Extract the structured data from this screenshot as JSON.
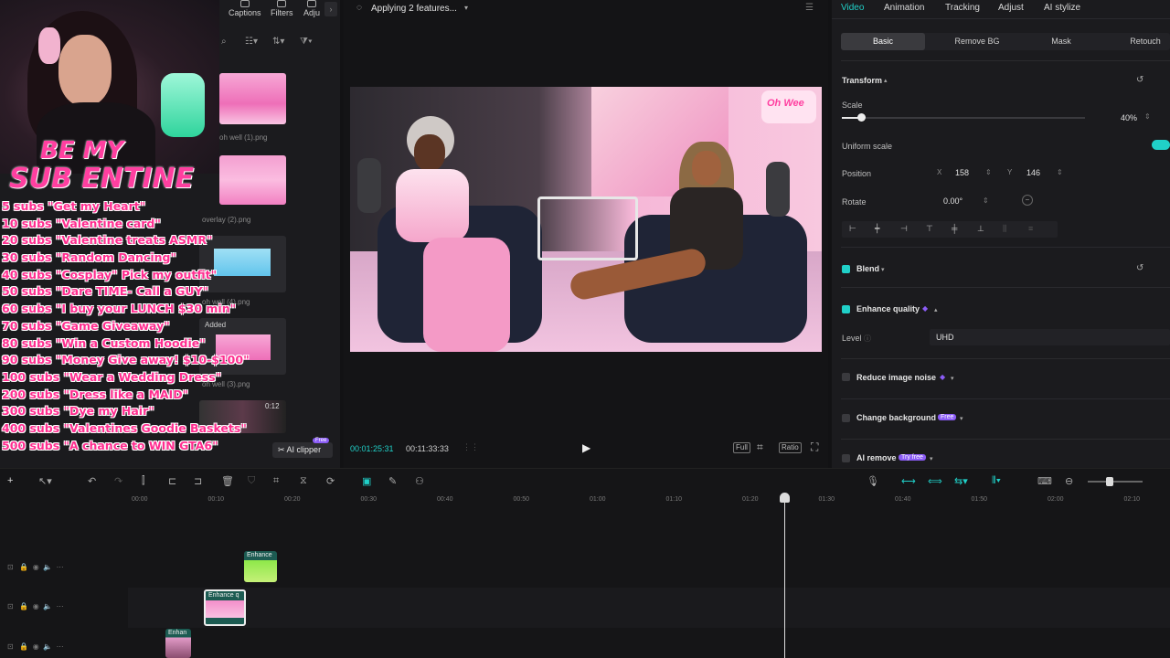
{
  "media_tabs": [
    "Captions",
    "Filters",
    "Adju"
  ],
  "media_items": [
    {
      "label": "oh well (1).png"
    },
    {
      "label": "overlay (2).png"
    },
    {
      "label": "oh well (4).png"
    },
    {
      "label": "oh well (3).png",
      "badge": "Added"
    },
    {
      "label": "0:12"
    }
  ],
  "ai_clipper": {
    "label": "AI clipper",
    "badge": "Free"
  },
  "webcam": {
    "line1": "BE MY",
    "line2": "SUB ENTINE"
  },
  "sub_goals": [
    "5 subs \"Get my Heart\"",
    "10 subs \"Valentine card\"",
    "20 subs \"Valentine treats ASMR\"",
    "30 subs \"Random Dancing\"",
    "40 subs \"Cosplay\" Pick my outfit\"",
    "50 subs \"Dare TIME- Call a GUY\"",
    "60 subs \"I buy your LUNCH $30 min\"",
    "70 subs \"Game Giveaway\"",
    "80 subs \"Win a Custom Hoodie\"",
    "90 subs \"Money Give away! $10-$100\"",
    "100 subs \"Wear a Wedding Dress\"",
    "200 subs \"Dress like a MAID\"",
    "300 subs \"Dye my Hair\"",
    "400 subs \"Valentines Goodie Baskets\"",
    "500 subs \"A chance to WIN GTA6\""
  ],
  "player": {
    "status": "Applying 2 features...",
    "current_time": "00:01:25:31",
    "total_time": "00:11:33:33",
    "btn_full": "Full",
    "btn_ratio": "Ratio",
    "logo_text": "Oh Wee"
  },
  "inspector": {
    "tabs": [
      "Video",
      "Animation",
      "Tracking",
      "Adjust",
      "AI stylize"
    ],
    "active_tab": "Video",
    "sub_tabs": [
      "Basic",
      "Remove BG",
      "Mask",
      "Retouch"
    ],
    "transform_title": "Transform",
    "scale_label": "Scale",
    "scale_value": "40%",
    "scale_fraction": 0.08,
    "uniform_scale_label": "Uniform scale",
    "position_label": "Position",
    "pos_x_label": "X",
    "pos_x": "158",
    "pos_y_label": "Y",
    "pos_y": "146",
    "rotate_label": "Rotate",
    "rotate_value": "0.00°",
    "blend_label": "Blend",
    "enhance_label": "Enhance quality",
    "level_label": "Level",
    "level_value": "UHD",
    "reduce_noise_label": "Reduce image noise",
    "change_bg_label": "Change background",
    "change_bg_badge": "Free",
    "ai_remove_label": "AI remove",
    "ai_remove_badge": "Try free"
  },
  "timeline": {
    "ticks": [
      "00:00",
      "00:10",
      "00:20",
      "00:30",
      "00:40",
      "00:50",
      "01:00",
      "01:10",
      "01:20",
      "01:30",
      "01:40",
      "01:50",
      "02:00",
      "02:10"
    ],
    "clips": [
      {
        "label": "Enhance"
      },
      {
        "label": "Enhance q"
      },
      {
        "label": "Enhan"
      }
    ]
  },
  "colors": {
    "accent": "#20d0c8",
    "neon_pink": "#ff2d8f",
    "badge_purple": "#8b5cf6"
  }
}
